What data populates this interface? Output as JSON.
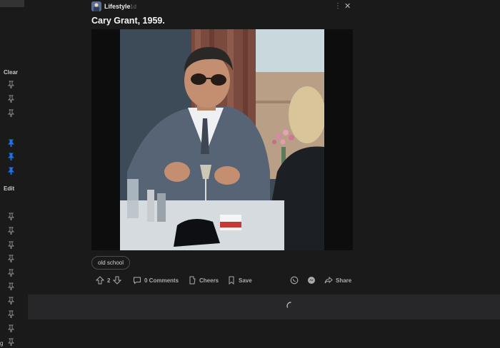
{
  "sidebar": {
    "clear_label": "Clear",
    "edit_label": "Edit",
    "corner_label": "g",
    "pins": [
      {
        "state": "unpinned"
      },
      {
        "state": "unpinned"
      },
      {
        "state": "unpinned"
      },
      {
        "state": "pinned"
      },
      {
        "state": "pinned"
      },
      {
        "state": "pinned"
      },
      {
        "state": "unpinned"
      },
      {
        "state": "unpinned"
      },
      {
        "state": "unpinned"
      },
      {
        "state": "unpinned"
      },
      {
        "state": "unpinned"
      },
      {
        "state": "unpinned"
      },
      {
        "state": "unpinned"
      },
      {
        "state": "unpinned"
      },
      {
        "state": "unpinned"
      },
      {
        "state": "unpinned"
      }
    ]
  },
  "post": {
    "subreddit": "Lifestyle",
    "age": "1d",
    "title": "Cary Grant, 1959.",
    "flair": "old school",
    "vote_count": "2",
    "comments_label": "0 Comments",
    "cheers_label": "Cheers",
    "save_label": "Save",
    "share_label": "Share"
  },
  "colors": {
    "background": "#1a1a1b",
    "pin_active": "#1a73e8",
    "pin_inactive": "#8a8c8e",
    "loader_bar": "#272729"
  }
}
